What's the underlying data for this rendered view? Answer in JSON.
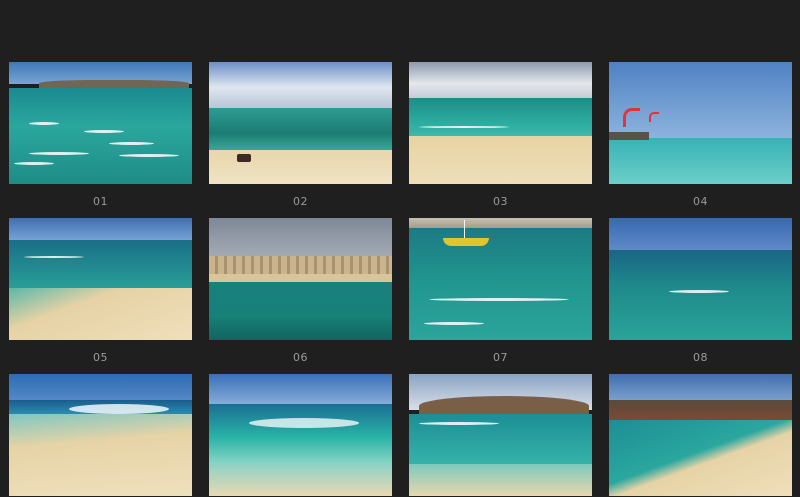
{
  "gallery": {
    "items": [
      {
        "caption": "01"
      },
      {
        "caption": "02"
      },
      {
        "caption": "03"
      },
      {
        "caption": "04"
      },
      {
        "caption": "05"
      },
      {
        "caption": "06"
      },
      {
        "caption": "07"
      },
      {
        "caption": "08"
      },
      {
        "caption": ""
      },
      {
        "caption": ""
      },
      {
        "caption": ""
      },
      {
        "caption": ""
      }
    ]
  },
  "colors": {
    "background": "#1f1f1f",
    "caption": "#9a9a9a",
    "sand": "#e8d4a6",
    "sea_turquoise": "#2aa8a0",
    "sea_deep": "#1a6f86",
    "sky": "#5b86c2"
  }
}
